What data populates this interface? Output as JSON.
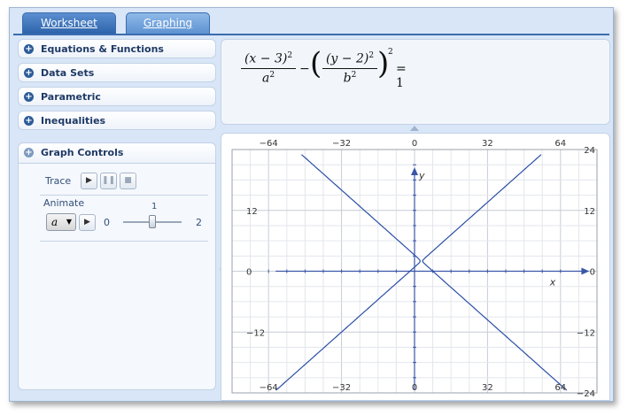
{
  "tabs": [
    {
      "label": "Worksheet"
    },
    {
      "label": "Graphing"
    }
  ],
  "sections": [
    {
      "label": "Equations & Functions"
    },
    {
      "label": "Data Sets"
    },
    {
      "label": "Parametric"
    },
    {
      "label": "Inequalities"
    }
  ],
  "graph_controls": {
    "title": "Graph Controls",
    "trace_label": "Trace",
    "animate_label": "Animate",
    "variable": "a",
    "slider_min": "0",
    "slider_max": "2",
    "slider_value": "1",
    "slider_level": 0.5
  },
  "equation": {
    "t1": "(x − 3)",
    "e1": "2",
    "d1": "a",
    "de1": "2",
    "minus": "−",
    "t2": "(y − 2)",
    "e2": "2",
    "d2": "b",
    "de2": "2",
    "rhs": "= 1"
  },
  "graph": {
    "x_ticks": [
      "−64",
      "−32",
      "0",
      "32",
      "64"
    ],
    "y_ticks_right": [
      "24",
      "12",
      "0",
      "−12",
      "−24"
    ],
    "y_ticks_left": [
      "12",
      "0",
      "−12"
    ],
    "x_axis_label": "x",
    "y_axis_label": "y",
    "xlim": [
      -80,
      80
    ],
    "ylim": [
      -24,
      24
    ]
  },
  "colors": {
    "tab_active": "#5a8fd0",
    "curve": "#2b4fa6",
    "grid": "#d9dde6"
  }
}
